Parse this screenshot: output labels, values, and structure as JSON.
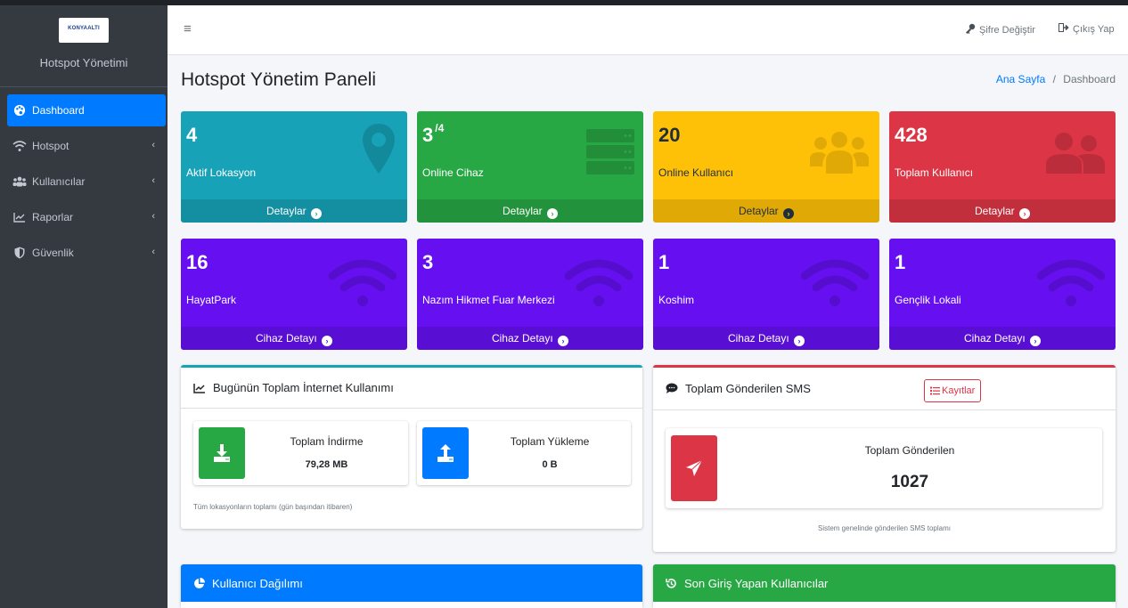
{
  "brand": {
    "logo_text": "KONYAALTI",
    "title": "Hotspot Yönetimi"
  },
  "sidebar": {
    "items": [
      {
        "label": "Dashboard",
        "icon": "palette-icon",
        "active": true
      },
      {
        "label": "Hotspot",
        "icon": "wifi-icon"
      },
      {
        "label": "Kullanıcılar",
        "icon": "users-icon"
      },
      {
        "label": "Raporlar",
        "icon": "chart-line-icon"
      },
      {
        "label": "Güvenlik",
        "icon": "shield-icon"
      }
    ],
    "chevron": "‹"
  },
  "header": {
    "menu_icon": "≡",
    "change_password": "Şifre Değiştir",
    "logout": "Çıkış Yap"
  },
  "page": {
    "title": "Hotspot Yönetim Paneli",
    "breadcrumb_home": "Ana Sayfa",
    "breadcrumb_sep": "/",
    "breadcrumb_current": "Dashboard"
  },
  "stats": [
    {
      "value": "4",
      "label": "Aktif Lokasyon",
      "footer": "Detaylar",
      "color": "#17a2b8",
      "icon": "map-marker-icon"
    },
    {
      "value": "3",
      "sup": "/4",
      "label": "Online Cihaz",
      "footer": "Detaylar",
      "color": "#28a745",
      "icon": "server-icon"
    },
    {
      "value": "20",
      "label": "Online Kullanıcı",
      "footer": "Detaylar",
      "color": "#ffc107",
      "icon": "users-icon"
    },
    {
      "value": "428",
      "label": "Toplam Kullanıcı",
      "footer": "Detaylar",
      "color": "#dc3545",
      "icon": "user-friends-icon"
    }
  ],
  "locations": [
    {
      "value": "16",
      "label": "HayatPark",
      "footer": "Cihaz Detayı",
      "color": "#6610f2"
    },
    {
      "value": "3",
      "label": "Nazım Hikmet Fuar Merkezi",
      "footer": "Cihaz Detayı",
      "color": "#6610f2"
    },
    {
      "value": "1",
      "label": "Koshim",
      "footer": "Cihaz Detayı",
      "color": "#6610f2"
    },
    {
      "value": "1",
      "label": "Gençlik Lokali",
      "footer": "Cihaz Detayı",
      "color": "#6610f2"
    }
  ],
  "internet": {
    "title": "Bugünün Toplam İnternet Kullanımı",
    "download_label": "Toplam İndirme",
    "download_value": "79,28 MB",
    "upload_label": "Toplam Yükleme",
    "upload_value": "0 B",
    "note": "Tüm lokasyonların toplamı (gün başından itibaren)"
  },
  "sms": {
    "title": "Toplam Gönderilen SMS",
    "records_button": "Kayıtlar",
    "total_label": "Toplam Gönderilen",
    "total_value": "1027",
    "note": "Sistem genelinde gönderilen SMS toplamı"
  },
  "bottom": {
    "distribution_title": "Kullanıcı Dağılımı",
    "recent_title": "Son Giriş Yapan Kullanıcılar"
  },
  "colors": {
    "primary": "#007bff",
    "info": "#17a2b8",
    "success": "#28a745",
    "warning": "#ffc107",
    "danger": "#dc3545",
    "indigo": "#6610f2",
    "sidebar": "#343a40"
  }
}
